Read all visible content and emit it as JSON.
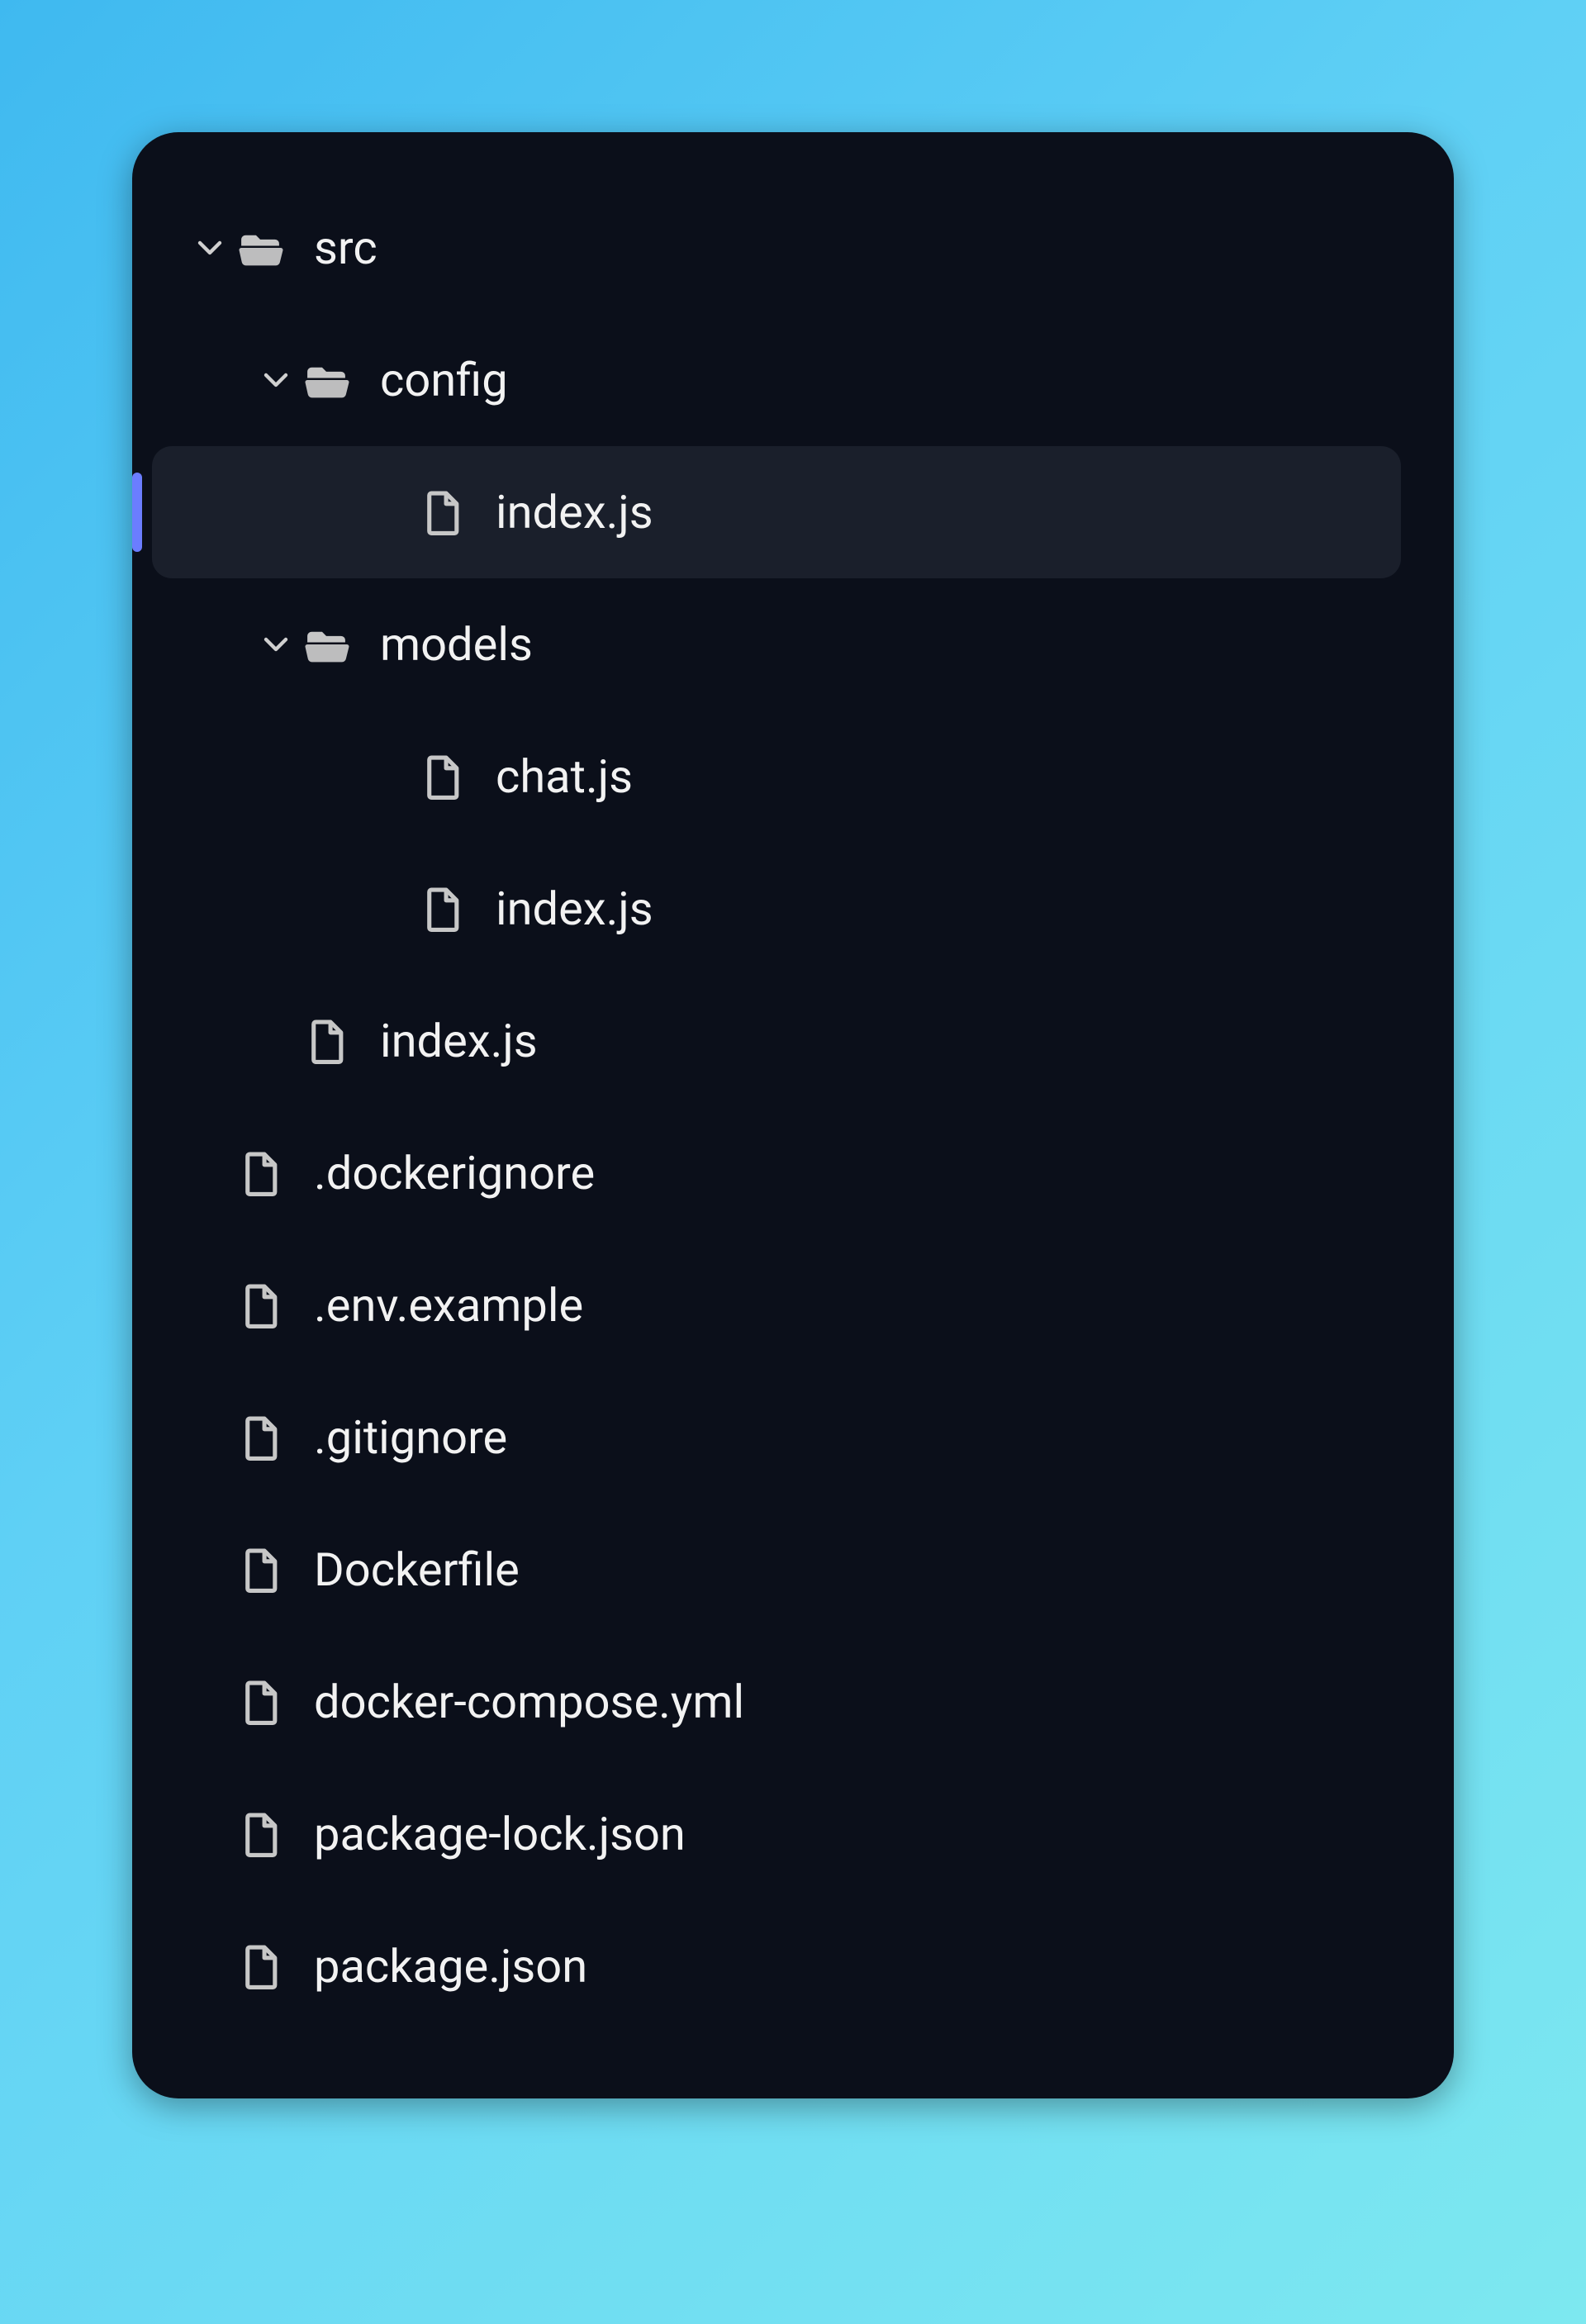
{
  "tree": [
    {
      "id": "src",
      "label": "src",
      "type": "folder",
      "indent": 0,
      "expanded": true,
      "active": false
    },
    {
      "id": "config",
      "label": "config",
      "type": "folder",
      "indent": 1,
      "expanded": true,
      "active": false
    },
    {
      "id": "config-index",
      "label": "index.js",
      "type": "file",
      "indent": 2,
      "expanded": false,
      "active": true
    },
    {
      "id": "models",
      "label": "models",
      "type": "folder",
      "indent": 1,
      "expanded": true,
      "active": false
    },
    {
      "id": "models-chat",
      "label": "chat.js",
      "type": "file",
      "indent": 2,
      "expanded": false,
      "active": false
    },
    {
      "id": "models-index",
      "label": "index.js",
      "type": "file",
      "indent": 2,
      "expanded": false,
      "active": false
    },
    {
      "id": "src-index",
      "label": "index.js",
      "type": "file",
      "indent": 1,
      "expanded": false,
      "active": false
    },
    {
      "id": "dockerignore",
      "label": ".dockerignore",
      "type": "file",
      "indent": 0,
      "expanded": false,
      "active": false
    },
    {
      "id": "env-example",
      "label": ".env.example",
      "type": "file",
      "indent": 0,
      "expanded": false,
      "active": false
    },
    {
      "id": "gitignore",
      "label": ".gitignore",
      "type": "file",
      "indent": 0,
      "expanded": false,
      "active": false
    },
    {
      "id": "dockerfile",
      "label": "Dockerfile",
      "type": "file",
      "indent": 0,
      "expanded": false,
      "active": false
    },
    {
      "id": "docker-compose",
      "label": "docker-compose.yml",
      "type": "file",
      "indent": 0,
      "expanded": false,
      "active": false
    },
    {
      "id": "package-lock",
      "label": "package-lock.json",
      "type": "file",
      "indent": 0,
      "expanded": false,
      "active": false
    },
    {
      "id": "package",
      "label": "package.json",
      "type": "file",
      "indent": 0,
      "expanded": false,
      "active": false
    }
  ]
}
